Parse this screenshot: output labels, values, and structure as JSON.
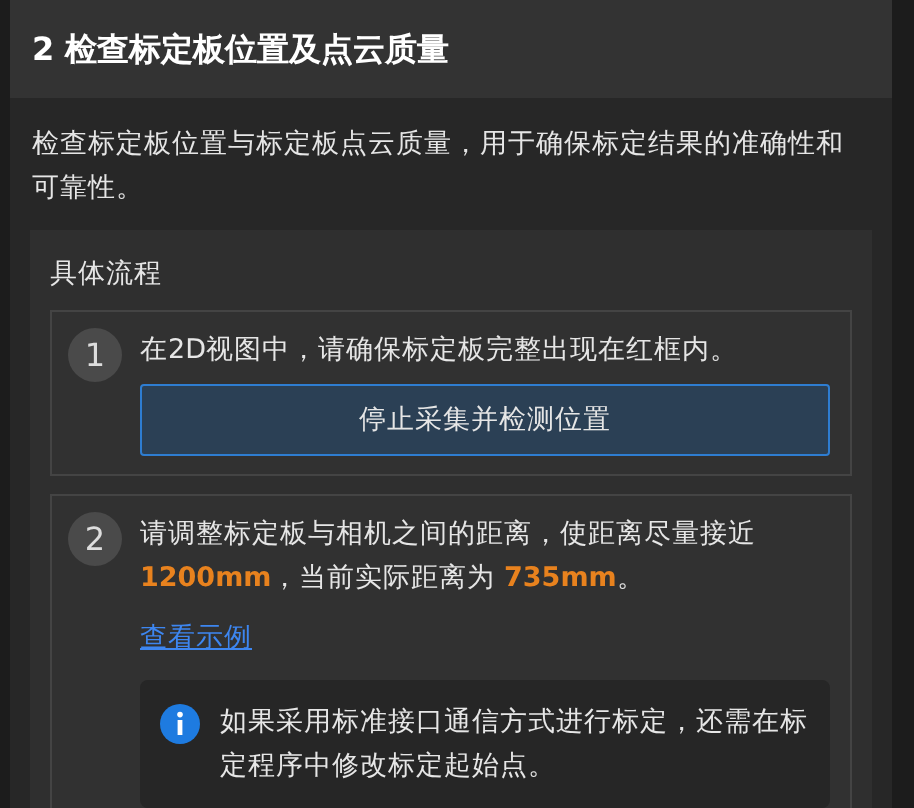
{
  "section": {
    "title": "2 检查标定板位置及点云质量",
    "description": "检查标定板位置与标定板点云质量，用于确保标定结果的准确性和可靠性。"
  },
  "procedure": {
    "title": "具体流程",
    "steps": [
      {
        "number": "1",
        "text": "在2D视图中，请确保标定板完整出现在红框内。",
        "button": "停止采集并检测位置"
      },
      {
        "number": "2",
        "text": "请调整标定板与相机之间的距离，使距离尽量接近 **1200mm**，当前实际距离为 **735mm**。",
        "link": "查看示例",
        "note": "如果采用标准接口通信方式进行标定，还需在标定程序中修改标定起始点。"
      }
    ]
  }
}
